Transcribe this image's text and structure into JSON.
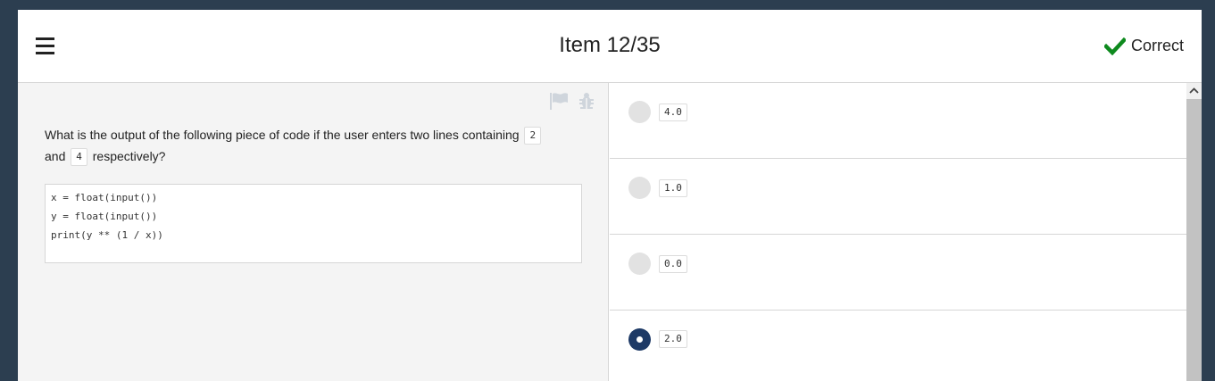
{
  "header": {
    "title": "Item 12/35",
    "status_label": "Correct",
    "status_icon": "checkmark-icon",
    "menu_icon": "hamburger-menu-icon"
  },
  "toolbar": {
    "flag_icon": "flag-icon",
    "report_icon": "bug-icon"
  },
  "question": {
    "text_part1": "What is the output of the following piece of code if the user enters two lines containing",
    "code1": "2",
    "text_part2": "and",
    "code2": "4",
    "text_part3": "respectively?",
    "code_lines": [
      "x = float(input())",
      "y = float(input())",
      "print(y ** (1 / x))"
    ]
  },
  "options": [
    {
      "value": "4.0",
      "selected": false
    },
    {
      "value": "1.0",
      "selected": false
    },
    {
      "value": "0.0",
      "selected": false
    },
    {
      "value": "2.0",
      "selected": true
    }
  ],
  "colors": {
    "background": "#2c3e50",
    "correct": "#2e9e3e",
    "selected_radio": "#1e3a66",
    "left_pane": "#f4f4f4"
  }
}
